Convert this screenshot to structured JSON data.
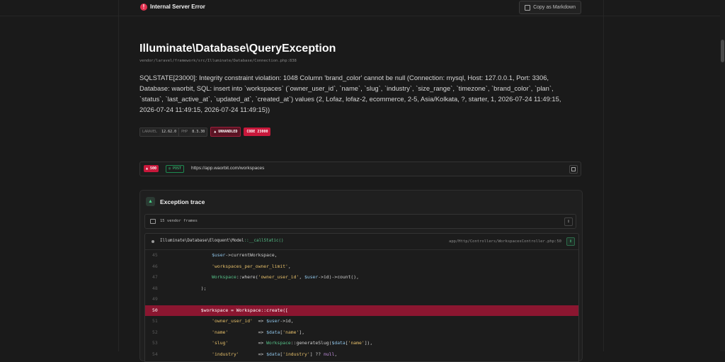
{
  "header": {
    "error_icon": "!",
    "title": "Internal Server Error",
    "copy_label": "Copy as Markdown"
  },
  "exception": {
    "class": "Illuminate\\Database\\QueryException",
    "file": "vendor/laravel/framework/src/Illuminate/Database/Connection.php:838",
    "message": "SQLSTATE[23000]: Integrity constraint violation: 1048 Column 'brand_color' cannot be null (Connection: mysql, Host: 127.0.0.1, Port: 3306, Database: waorbit, SQL: insert into `workspaces` (`owner_user_id`, `name`, `slug`, `industry`, `size_range`, `timezone`, `brand_color`, `plan`, `status`, `last_active_at`, `updated_at`, `created_at`) values (2, Lofaz, lofaz-2, ecommerce, 2-5, Asia/Kolkata, ?, starter, 1, 2026-07-24 11:49:15, 2026-07-24 11:49:15, 2026-07-24 11:49:15))"
  },
  "badges": {
    "laravel_label": "LARAVEL",
    "laravel_version": "12.62.0",
    "php_label": "PHP",
    "php_version": "8.3.30",
    "unhandled": "UNHANDLED",
    "code": "CODE 23000"
  },
  "request": {
    "status": "500",
    "method": "POST",
    "url": "https://app.waorbit.com/workspaces"
  },
  "trace": {
    "icon": "▲",
    "title": "Exception trace",
    "vendor_frames": "15 vendor frames",
    "frame": {
      "class": "Illuminate\\Database\\Eloquent\\Model",
      "method": "::__callStatic()",
      "path": "app/Http/Controllers/WorkspacesController.php:50"
    },
    "lines": [
      {
        "n": "45",
        "t": "            $user->currentWorkspace,"
      },
      {
        "n": "46",
        "t": "            'workspaces_per_owner_limit',"
      },
      {
        "n": "47",
        "t": "            Workspace::where('owner_user_id', $user->id)->count(),"
      },
      {
        "n": "48",
        "t": "        );"
      },
      {
        "n": "49",
        "t": ""
      },
      {
        "n": "50",
        "t": "        $workspace = Workspace::create(["
      },
      {
        "n": "51",
        "t": "            'owner_user_id'  => $user->id,"
      },
      {
        "n": "52",
        "t": "            'name'           => $data['name'],"
      },
      {
        "n": "53",
        "t": "            'slug'           => Workspace::generateSlug($data['name']),"
      },
      {
        "n": "54",
        "t": "            'industry'       => $data['industry'] ?? null,"
      }
    ]
  },
  "colors": {
    "accent_red": "#c8183b",
    "highlight_line": "#8b1630",
    "accent_green": "#4ad48a"
  }
}
